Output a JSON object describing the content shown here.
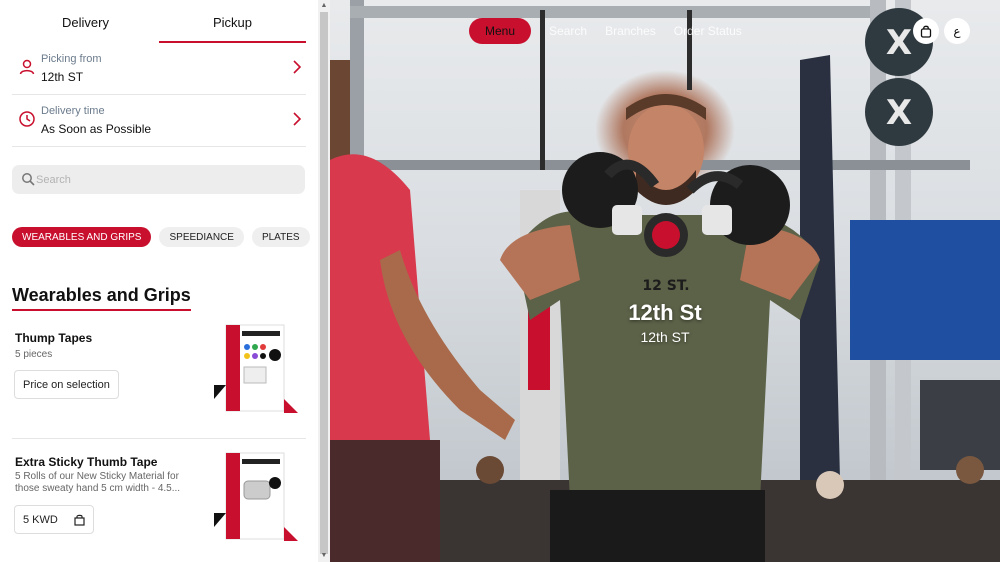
{
  "tabs": {
    "delivery": "Delivery",
    "pickup": "Pickup"
  },
  "picking": {
    "label": "Picking from",
    "value": "12th ST"
  },
  "delivery_time": {
    "label": "Delivery time",
    "value": "As Soon as Possible"
  },
  "search": {
    "placeholder": "Search"
  },
  "categories": [
    "WEARABLES AND GRIPS",
    "SPEEDIANCE",
    "PLATES"
  ],
  "section_title": "Wearables and Grips",
  "products": [
    {
      "name": "Thump Tapes",
      "desc": "5 pieces",
      "price": "Price on selection"
    },
    {
      "name": "Extra Sticky Thumb Tape",
      "desc": "5 Rolls of our New Sticky Material for those sweaty hand 5 cm width - 4.5...",
      "price": "5 KWD"
    }
  ],
  "nav": {
    "menu": "Menu",
    "search": "Search",
    "branches": "Branches",
    "order_status": "Order Status"
  },
  "lang_toggle": "ع",
  "hero": {
    "title": "12th St",
    "subtitle": "12th ST"
  },
  "colors": {
    "accent": "#c8102e"
  }
}
